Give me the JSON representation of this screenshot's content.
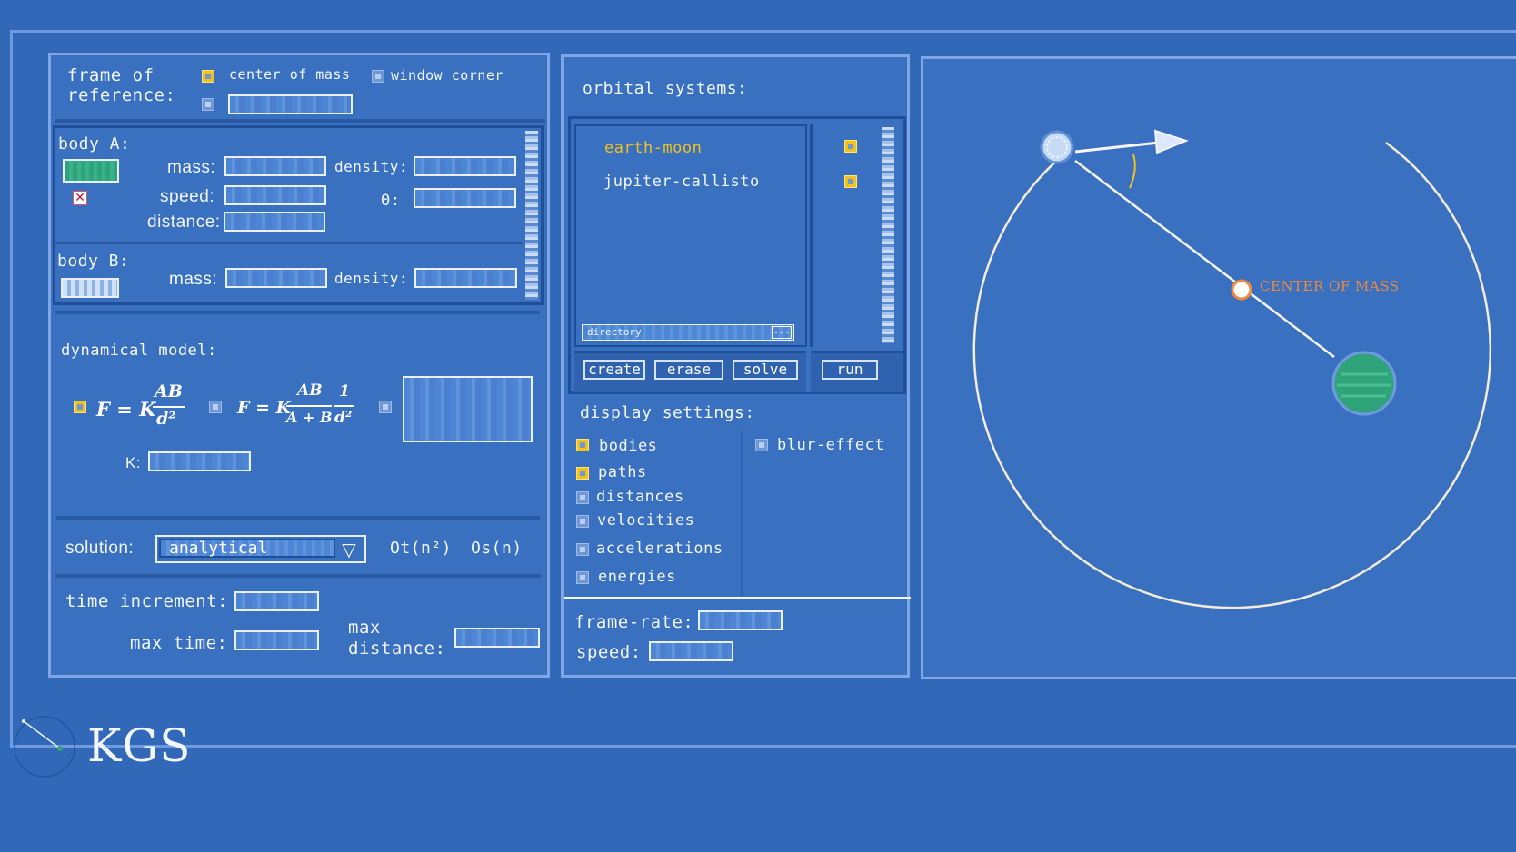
{
  "frame_of_reference": {
    "label_line1": "frame of",
    "label_line2": "reference:",
    "option_center": "center of mass",
    "option_window": "window corner"
  },
  "body_a": {
    "title": "body A:",
    "mass_label": "mass:",
    "density_label": "density:",
    "speed_label": "speed:",
    "theta_label": "Θ:",
    "distance_label": "distance:"
  },
  "body_b": {
    "title": "body B:",
    "mass_label": "mass:",
    "density_label": "density:"
  },
  "dynamical_model": {
    "title": "dynamical model:",
    "formula1_lhs": "F = K",
    "formula1_num": "AB",
    "formula1_den": "d²",
    "formula2_lhs": "F = K",
    "formula2_num": "AB",
    "formula2_den": "A + B",
    "formula2_num2": "1",
    "formula2_den2": "d²",
    "k_label": "K:"
  },
  "solution": {
    "label": "solution:",
    "selected": "analytical",
    "time_complexity": "Ot(n²)",
    "space_complexity": "Os(n)"
  },
  "limits": {
    "time_increment_label": "time increment:",
    "max_time_label": "max time:",
    "max_distance_line1": "max",
    "max_distance_line2": "distance:"
  },
  "orbital_systems": {
    "title": "orbital systems:",
    "items": [
      "earth-moon",
      "jupiter-callisto"
    ],
    "selected_index": 0,
    "directory_label": "directory",
    "browse_label": "...",
    "buttons": {
      "create": "create",
      "erase": "erase",
      "solve": "solve",
      "run": "run"
    }
  },
  "display_settings": {
    "title": "display settings:",
    "options": [
      {
        "label": "bodies",
        "checked": true
      },
      {
        "label": "paths",
        "checked": true
      },
      {
        "label": "distances",
        "checked": false
      },
      {
        "label": "velocities",
        "checked": false
      },
      {
        "label": "accelerations",
        "checked": false
      },
      {
        "label": "energies",
        "checked": false
      }
    ],
    "blur_label": "blur-effect",
    "blur_checked": false,
    "frame_rate_label": "frame-rate:",
    "speed_label": "speed:"
  },
  "simulation": {
    "center_label": "CENTER OF MASS"
  },
  "logo": {
    "text": "KGS"
  },
  "colors": {
    "background": "#3268b8",
    "accent": "#f2c21b",
    "center_of_mass": "#f08a3a",
    "body_b": "#2fa37a"
  }
}
